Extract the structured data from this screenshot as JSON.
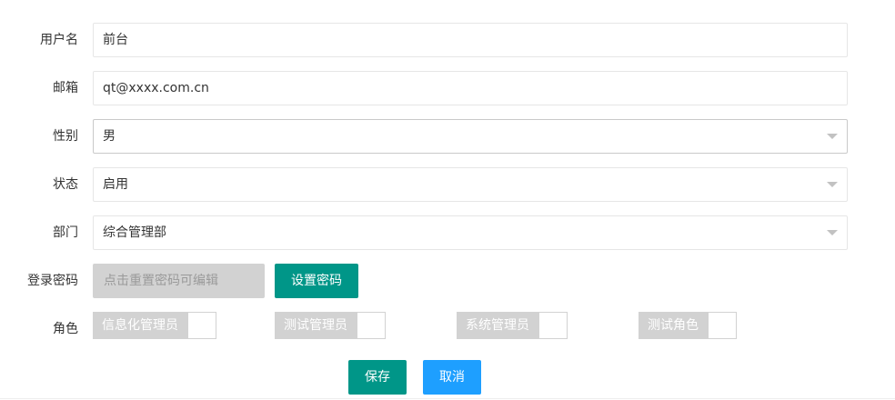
{
  "form": {
    "username": {
      "label": "用户名",
      "value": "前台"
    },
    "email": {
      "label": "邮箱",
      "value": "qt@xxxx.com.cn"
    },
    "gender": {
      "label": "性别",
      "value": "男"
    },
    "status": {
      "label": "状态",
      "value": "启用"
    },
    "department": {
      "label": "部门",
      "value": "综合管理部"
    },
    "password": {
      "label": "登录密码",
      "placeholder": "点击重置密码可编辑",
      "set_button": "设置密码"
    },
    "roles": {
      "label": "角色",
      "items": [
        {
          "label": "信息化管理员",
          "checked": false
        },
        {
          "label": "测试管理员",
          "checked": false
        },
        {
          "label": "系统管理员",
          "checked": false
        },
        {
          "label": "测试角色",
          "checked": false
        }
      ]
    },
    "actions": {
      "save": "保存",
      "cancel": "取消"
    }
  },
  "colors": {
    "primary_green": "#009688",
    "primary_blue": "#1e9fff",
    "disabled_gray": "#d2d2d2"
  },
  "icons": {
    "select_caret": "chevron-down-icon"
  }
}
